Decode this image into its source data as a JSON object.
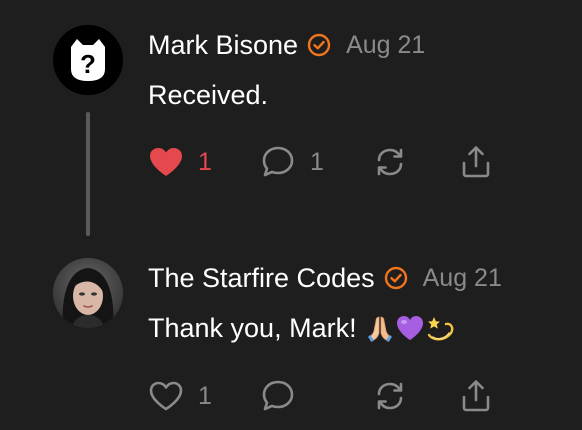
{
  "comments": [
    {
      "author": "Mark Bisone",
      "verified": true,
      "date": "Aug 21",
      "text": "Received.",
      "likes": "1",
      "liked": true,
      "replies": "1"
    },
    {
      "author": "The Starfire Codes",
      "verified": true,
      "date": "Aug 21",
      "text": "Thank you, Mark!",
      "emojis": [
        "folded-hands",
        "purple-heart",
        "dizzy"
      ],
      "likes": "1",
      "liked": false,
      "replies": ""
    }
  ],
  "colors": {
    "background": "#1e1e1e",
    "text": "#ffffff",
    "muted": "#8a8a8a",
    "verified_badge": "#f0761e",
    "like_active": "#e5484d",
    "thread_line": "#5a5a5a"
  },
  "icons": {
    "like": "heart-icon",
    "reply": "comment-bubble-icon",
    "restack": "restack-icon",
    "share": "share-icon",
    "verified": "verified-badge-icon"
  }
}
